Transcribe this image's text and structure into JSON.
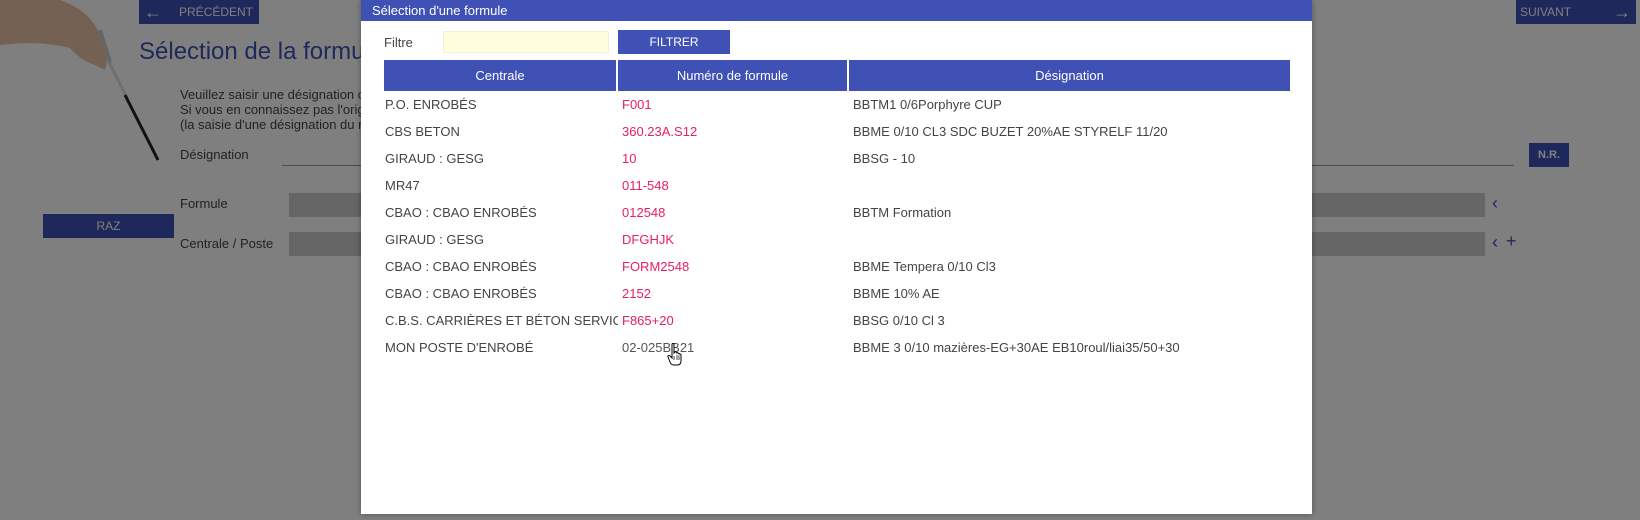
{
  "background": {
    "prev_label": "PRÉCÉDENT",
    "next_label": "SUIVANT",
    "title": "Sélection de la formu",
    "help_lines": [
      "Veuillez saisir une désignation c",
      "Si vous en connaissez pas l'origi",
      "(la saisie d'une désignation du n"
    ],
    "designation_label": "Désignation",
    "formule_label": "Formule",
    "centrale_label": "Centrale / Poste",
    "raz_label": "RAZ",
    "nr_label": "N.R."
  },
  "modal": {
    "title": "Sélection d'une formule",
    "filter_label": "Filtre",
    "filter_value": "",
    "filter_button": "FILTRER",
    "columns": [
      "Centrale",
      "Numéro de formule",
      "Désignation"
    ],
    "rows": [
      {
        "centrale": "P.O. ENROBÉS",
        "numero": "F001",
        "designation": "BBTM1 0/6Porphyre CUP"
      },
      {
        "centrale": "CBS BETON",
        "numero": "360.23A.S12",
        "designation": "BBME 0/10 CL3 SDC BUZET 20%AE STYRELF 11/20"
      },
      {
        "centrale": "GIRAUD : GESG",
        "numero": "10",
        "designation": "BBSG - 10"
      },
      {
        "centrale": "MR47",
        "numero": "011-548",
        "designation": ""
      },
      {
        "centrale": "CBAO : CBAO ENROBÉS",
        "numero": "012548",
        "designation": "BBTM Formation"
      },
      {
        "centrale": "GIRAUD : GESG",
        "numero": "DFGHJK",
        "designation": ""
      },
      {
        "centrale": "CBAO : CBAO ENROBÉS",
        "numero": "FORM2548",
        "designation": "BBME Tempera 0/10 Cl3"
      },
      {
        "centrale": "CBAO : CBAO ENROBÉS",
        "numero": "2152",
        "designation": "BBME 10% AE"
      },
      {
        "centrale": "C.B.S. CARRIÈRES ET BÉTON SERVICE",
        "numero": "F865+20",
        "designation": "BBSG 0/10 Cl 3"
      },
      {
        "centrale": "MON POSTE D'ENROBÉ",
        "numero": "02-025BB21",
        "designation": "BBME 3 0/10 mazières-EG+30AE EB10roul/liai35/50+30"
      }
    ]
  },
  "colors": {
    "accent": "#3f51b5",
    "link": "#e91e63",
    "filter_bg": "#ffffe0"
  },
  "icons": {
    "prev": "arrow-left-icon",
    "next": "arrow-right-icon",
    "collapse": "chevron-left-icon",
    "add": "plus-icon",
    "cursor": "hand-pointer-icon"
  }
}
